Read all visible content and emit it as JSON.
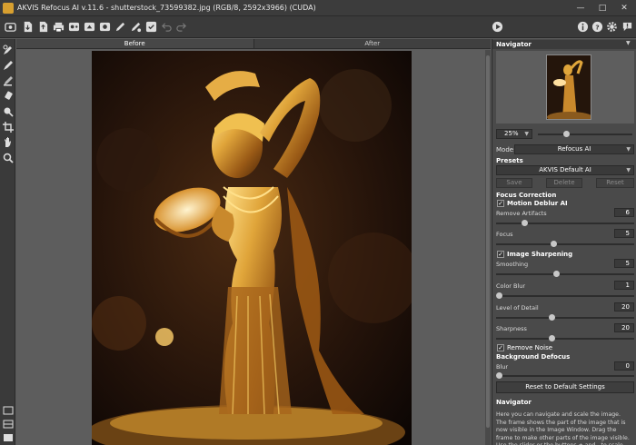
{
  "window": {
    "title": "AKVIS Refocus AI v.11.6 - shutterstock_73599382.jpg (RGB/8, 2592x3966) (CUDA)",
    "controls": [
      "minimize-icon",
      "maximize-icon",
      "close-icon"
    ]
  },
  "toolbar": {
    "left_icons": [
      "home-icon",
      "open-icon",
      "save-icon",
      "print-icon",
      "batch-icon",
      "preset-icon",
      "plugin-icon",
      "brush-icon",
      "settings-icon",
      "check-icon",
      "undo-icon",
      "redo-icon"
    ],
    "right_icons": [
      "run-icon",
      "info-icon",
      "help-icon",
      "gear-icon",
      "notify-icon"
    ]
  },
  "tools": [
    "focus-brush-icon",
    "pen-icon",
    "eraser-icon",
    "smudge-icon",
    "stamp-icon",
    "crop-icon",
    "hand-icon",
    "zoom-icon"
  ],
  "tabs": {
    "before": "Before",
    "after": "After"
  },
  "navigator": {
    "heading": "Navigator",
    "zoom": "25%"
  },
  "mode": {
    "label": "Mode:",
    "value": "Refocus AI"
  },
  "presets": {
    "heading": "Presets",
    "selected": "AKVIS Default AI",
    "save": "Save",
    "delete": "Delete",
    "reset": "Reset"
  },
  "focus_correction": {
    "heading": "Focus Correction",
    "motion_deblur": "Motion Deblur AI",
    "params": [
      {
        "label": "Remove Artifacts",
        "value": "6",
        "fraction": 0.2
      },
      {
        "label": "Focus",
        "value": "5",
        "fraction": 0.45
      }
    ],
    "image_sharpening": "Image Sharpening",
    "sharp_params": [
      {
        "label": "Smoothing",
        "value": "5",
        "fraction": 0.45
      },
      {
        "label": "Color Blur",
        "value": "1",
        "fraction": 0.02
      },
      {
        "label": "Level of Detail",
        "value": "20",
        "fraction": 0.4
      },
      {
        "label": "Sharpness",
        "value": "20",
        "fraction": 0.4
      }
    ],
    "remove_noise": "Remove Noise"
  },
  "background_defocus": {
    "heading": "Background Defocus",
    "blur_label": "Blur",
    "blur_value": "0",
    "blur_fraction": 0.02
  },
  "reset_defaults": "Reset to Default Settings",
  "help": {
    "title": "Navigator",
    "text": "Here you can navigate and scale the image. The frame shows the part of the image that is now visible in the Image Window. Drag the frame to make other parts of the image visible. Use the slider or the buttons + and - to scale the image."
  }
}
